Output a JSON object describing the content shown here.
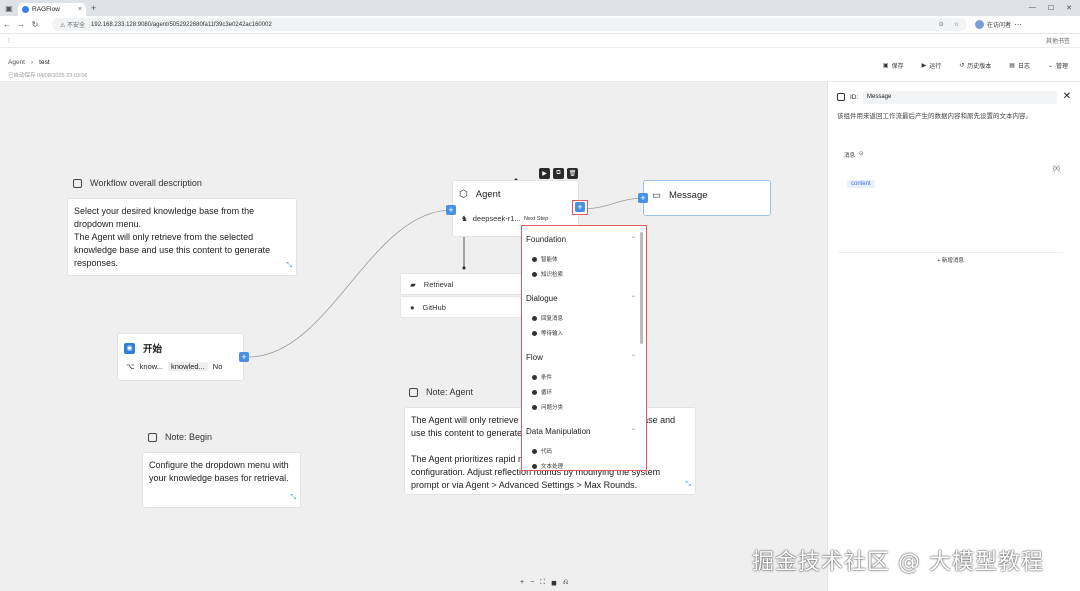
{
  "browser": {
    "tab_title": "RAGFlow",
    "tab_close": "×",
    "new_tab": "+",
    "url_warning": "⚠ 不安全",
    "url": "192.168.233.128:9080/agent/5052922680fa11f39c3e0242ac160002",
    "profile": "在访问者",
    "bookmarks_right": "其他书签"
  },
  "header": {
    "breadcrumb_root": "Agent",
    "breadcrumb_sep": "›",
    "breadcrumb_current": "test",
    "saved_text": "已自动保存 04/08/2025 23:03:06",
    "buttons": [
      {
        "icon": "save-icon",
        "glyph": "▣",
        "label": "保存"
      },
      {
        "icon": "run-icon",
        "glyph": "▶",
        "label": "运行"
      },
      {
        "icon": "history-icon",
        "glyph": "↺",
        "label": "历史版本"
      },
      {
        "icon": "log-icon",
        "glyph": "▤",
        "label": "日志"
      },
      {
        "icon": "manage-icon",
        "glyph": "⌄",
        "label": "管理"
      }
    ]
  },
  "canvas": {
    "notes": {
      "workflow": {
        "title": "Workflow overall description",
        "body": "Select your desired knowledge base from the dropdown menu.\nThe Agent will only retrieve from the selected knowledge base and use this content  to generate responses."
      },
      "agent": {
        "title": "Note: Agent",
        "body": "The Agent will only retrieve from the selected knowledge base and use this content  to generate responses.\n\nThe Agent prioritizes rapid responses. You can adjust its configuration. Adjust reflection rounds by modifying the system prompt or via Agent > Advanced Settings > Max Rounds."
      },
      "begin": {
        "title": "Note: Begin",
        "body": "Configure the dropdown menu with your knowledge bases for retrieval."
      }
    },
    "start_node": {
      "title": "开始",
      "param_name": "know...",
      "param_value": "knowled...",
      "param_flag": "No"
    },
    "agent_node": {
      "title": "Agent",
      "model": "deepseek-r1..."
    },
    "message_node": {
      "title": "Message"
    },
    "tools": [
      {
        "icon": "retrieval-icon",
        "label": "Retrieval"
      },
      {
        "icon": "github-icon",
        "label": "GitHub"
      }
    ],
    "dropdown": {
      "header": "Next Step",
      "groups": [
        {
          "name": "Foundation",
          "items": [
            "智能体",
            "知识检索"
          ]
        },
        {
          "name": "Dialogue",
          "items": [
            "回复消息",
            "等待输入"
          ]
        },
        {
          "name": "Flow",
          "items": [
            "条件",
            "循环",
            "问题分类"
          ]
        },
        {
          "name": "Data Manipulation",
          "items": [
            "代码",
            "文本处理"
          ]
        }
      ]
    },
    "zoom_controls": [
      "+",
      "−",
      "⛶",
      "◼",
      "⎌"
    ]
  },
  "panel": {
    "id_label": "ID:",
    "id_value": "Message",
    "description": "该组件用来返回工作流最后产生的数据内容和原先设置的文本内容。",
    "message_label": "消息",
    "message_label_icon": "⊙",
    "var_button": "{x}",
    "content_tag": "content",
    "add_button": "+ 新增消息"
  },
  "watermark": "掘金技术社区 @ 大模型教程",
  "colors": {
    "accent": "#4a90e2",
    "dropdown_border": "#e05a5a"
  }
}
